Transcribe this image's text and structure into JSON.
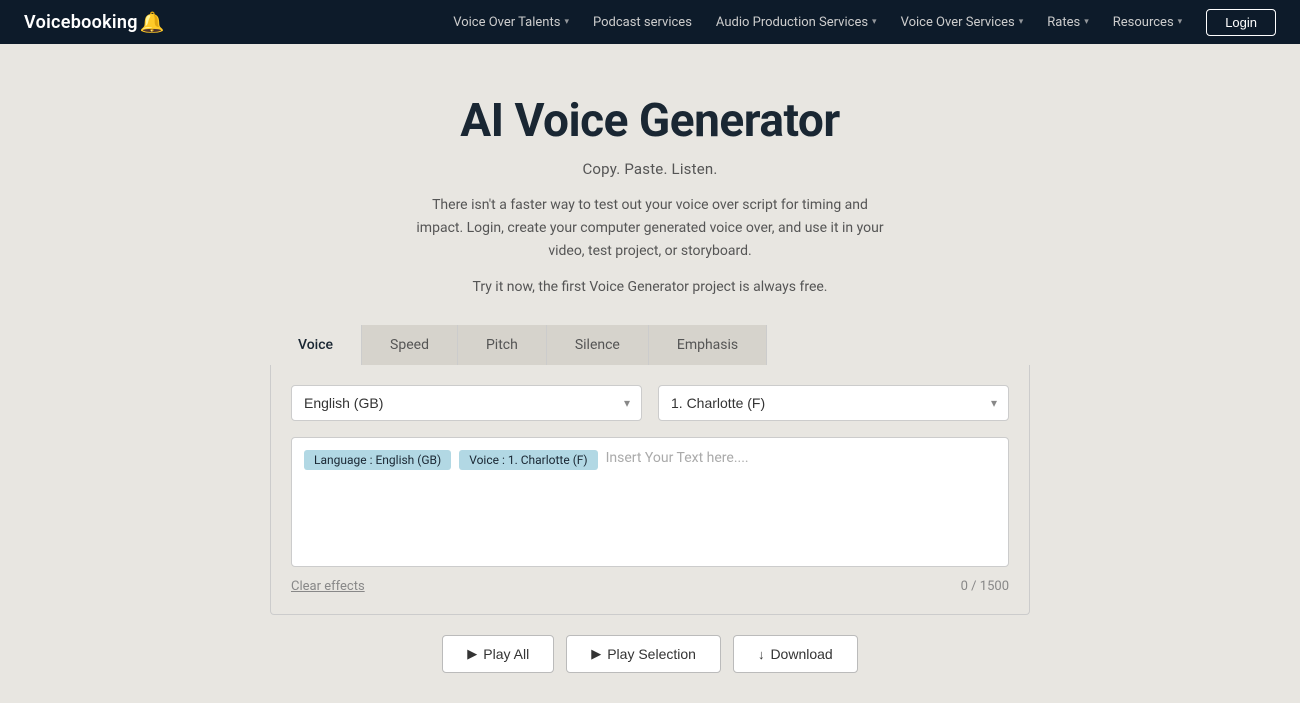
{
  "navbar": {
    "logo_text": "Voicebooking",
    "logo_icon": "🔔",
    "nav_items": [
      {
        "label": "Voice Over Talents",
        "has_chevron": true
      },
      {
        "label": "Podcast services",
        "has_chevron": false
      },
      {
        "label": "Audio Production Services",
        "has_chevron": true
      },
      {
        "label": "Voice Over Services",
        "has_chevron": true
      },
      {
        "label": "Rates",
        "has_chevron": true
      },
      {
        "label": "Resources",
        "has_chevron": true
      }
    ],
    "login_label": "Login"
  },
  "hero": {
    "title": "AI Voice Generator",
    "subtitle": "Copy. Paste. Listen.",
    "description": "There isn't a faster way to test out your voice over script for timing and impact. Login, create your computer generated voice over, and use it in your video, test project, or storyboard.",
    "free_note": "Try it now, the first Voice Generator project is always free."
  },
  "tabs": [
    {
      "id": "voice",
      "label": "Voice",
      "active": true
    },
    {
      "id": "speed",
      "label": "Speed",
      "active": false
    },
    {
      "id": "pitch",
      "label": "Pitch",
      "active": false
    },
    {
      "id": "silence",
      "label": "Silence",
      "active": false
    },
    {
      "id": "emphasis",
      "label": "Emphasis",
      "active": false
    }
  ],
  "panel": {
    "language_placeholder": "English (GB)",
    "language_value": "English (GB)",
    "voice_placeholder": "1. Charlotte (F)",
    "voice_value": "1. Charlotte (F)",
    "tag_language": "Language : English (GB)",
    "tag_voice": "Voice : 1. Charlotte (F)",
    "text_placeholder": "Insert Your Text here....",
    "char_count": "0 / 1500",
    "clear_effects": "Clear effects"
  },
  "action_buttons": [
    {
      "id": "play-all",
      "icon": "▶",
      "label": "Play All"
    },
    {
      "id": "play-selection",
      "icon": "▶",
      "label": "Play Selection"
    },
    {
      "id": "download",
      "icon": "↓",
      "label": "Download"
    }
  ]
}
